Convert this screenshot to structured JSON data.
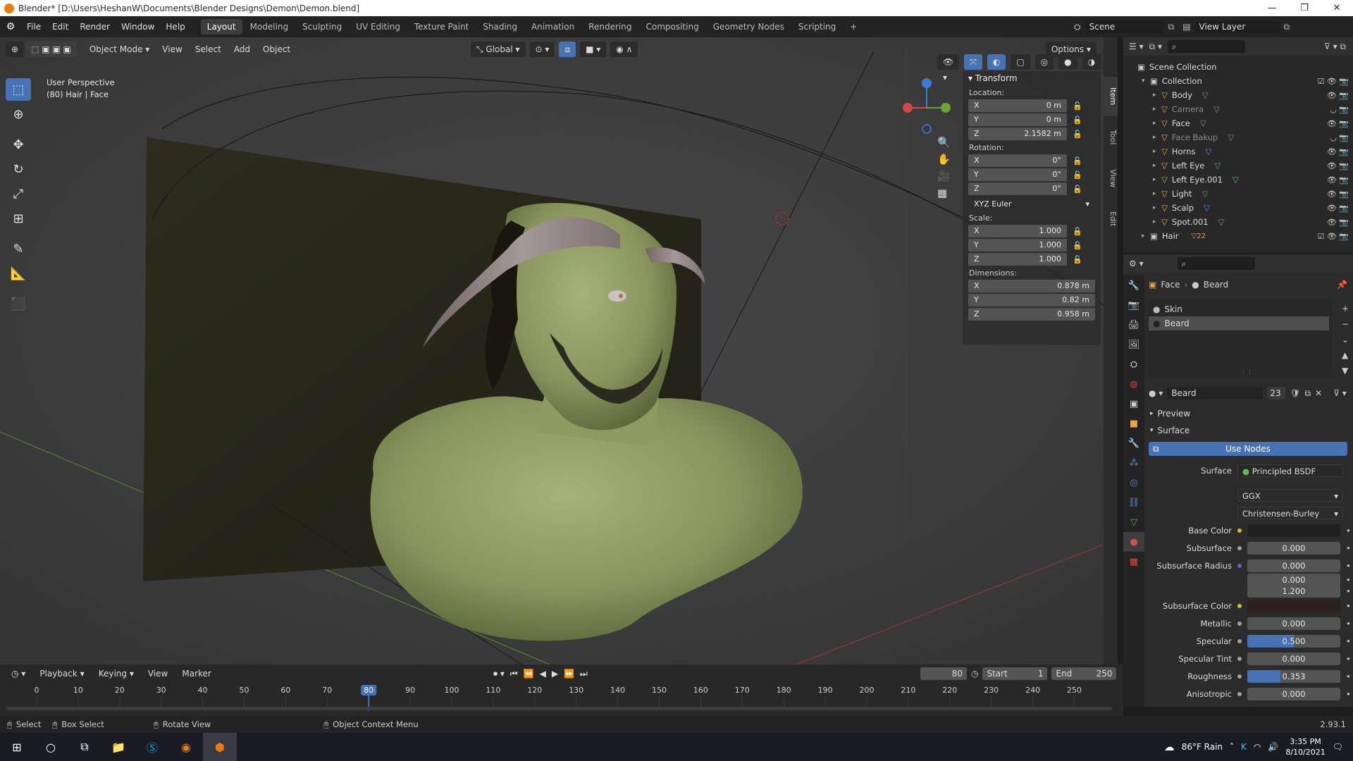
{
  "window": {
    "title": "Blender* [D:\\Users\\HeshanW\\Documents\\Blender Designs\\Demon\\Demon.blend]"
  },
  "menu": [
    "File",
    "Edit",
    "Render",
    "Window",
    "Help"
  ],
  "workspaces": [
    "Layout",
    "Modeling",
    "Sculpting",
    "UV Editing",
    "Texture Paint",
    "Shading",
    "Animation",
    "Rendering",
    "Compositing",
    "Geometry Nodes",
    "Scripting"
  ],
  "scene": {
    "scene_name": "Scene",
    "view_layer": "View Layer"
  },
  "viewport": {
    "mode": "Object Mode",
    "header_menus": [
      "View",
      "Select",
      "Add",
      "Object"
    ],
    "orientation": "Global",
    "options_label": "Options",
    "overlay_line1": "User Perspective",
    "overlay_line2": "(80) Hair | Face",
    "side_tabs": [
      "Item",
      "Tool",
      "View",
      "Edit"
    ]
  },
  "transform": {
    "title": "Transform",
    "location_label": "Location:",
    "location": {
      "x": "0 m",
      "y": "0 m",
      "z": "2.1582 m"
    },
    "rotation_label": "Rotation:",
    "rotation": {
      "x": "0°",
      "y": "0°",
      "z": "0°"
    },
    "rotation_mode": "XYZ Euler",
    "scale_label": "Scale:",
    "scale": {
      "x": "1.000",
      "y": "1.000",
      "z": "1.000"
    },
    "dimensions_label": "Dimensions:",
    "dimensions": {
      "x": "0.878 m",
      "y": "0.82 m",
      "z": "0.958 m"
    },
    "axis": {
      "x": "X",
      "y": "Y",
      "z": "Z"
    }
  },
  "outliner": {
    "root": "Scene Collection",
    "collection": "Collection",
    "items": [
      {
        "name": "Body",
        "dim": false
      },
      {
        "name": "Camera",
        "dim": true
      },
      {
        "name": "Face",
        "dim": false
      },
      {
        "name": "Face Bakup",
        "dim": true
      },
      {
        "name": "Horns",
        "dim": false
      },
      {
        "name": "Left Eye",
        "dim": false
      },
      {
        "name": "Left Eye.001",
        "dim": false
      },
      {
        "name": "Light",
        "dim": false
      },
      {
        "name": "Scalp",
        "dim": false
      },
      {
        "name": "Spot.001",
        "dim": false
      }
    ],
    "hair_collection": "Hair",
    "hair_badge": "22"
  },
  "properties": {
    "breadcrumb_object": "Face",
    "breadcrumb_material": "Beard",
    "material_slots": [
      "Skin",
      "Beard"
    ],
    "material_name": "Beard",
    "material_users": "23",
    "preview_label": "Preview",
    "surface_label": "Surface",
    "use_nodes": "Use Nodes",
    "surface_shader_label": "Surface",
    "surface_shader": "Principled BSDF",
    "distribution": "GGX",
    "subsurface_method": "Christensen-Burley",
    "rows": [
      {
        "label": "Base Color",
        "value": "",
        "fill": 0
      },
      {
        "label": "Subsurface",
        "value": "0.000",
        "fill": 0
      },
      {
        "label": "Subsurface Radius",
        "value": "0.000",
        "fill": 0
      },
      {
        "label": "",
        "value": "0.000",
        "fill": 0
      },
      {
        "label": "",
        "value": "1.200",
        "fill": 0
      },
      {
        "label": "Subsurface Color",
        "value": "",
        "fill": 0
      },
      {
        "label": "Metallic",
        "value": "0.000",
        "fill": 0
      },
      {
        "label": "Specular",
        "value": "0.500",
        "fill": 0.5
      },
      {
        "label": "Specular Tint",
        "value": "0.000",
        "fill": 0
      },
      {
        "label": "Roughness",
        "value": "0.353",
        "fill": 0.353
      },
      {
        "label": "Anisotropic",
        "value": "0.000",
        "fill": 0
      }
    ]
  },
  "timeline": {
    "menus": [
      "Playback",
      "Keying",
      "View",
      "Marker"
    ],
    "current_frame": "80",
    "start_label": "Start",
    "start": "1",
    "end_label": "End",
    "end": "250",
    "ticks": [
      "0",
      "10",
      "20",
      "30",
      "40",
      "50",
      "60",
      "70",
      "80",
      "90",
      "100",
      "110",
      "120",
      "130",
      "140",
      "150",
      "160",
      "170",
      "180",
      "190",
      "200",
      "210",
      "220",
      "230",
      "240",
      "250"
    ]
  },
  "status": {
    "select": "Select",
    "box_select": "Box Select",
    "rotate_view": "Rotate View",
    "context_menu": "Object Context Menu",
    "version": "2.93.1"
  },
  "taskbar": {
    "weather": "86°F  Rain",
    "time": "3:35 PM",
    "date": "8/10/2021"
  },
  "colors": {
    "accent": "#4772b3",
    "blender_orange": "#e87d0d",
    "skin": "#8f9a63"
  }
}
